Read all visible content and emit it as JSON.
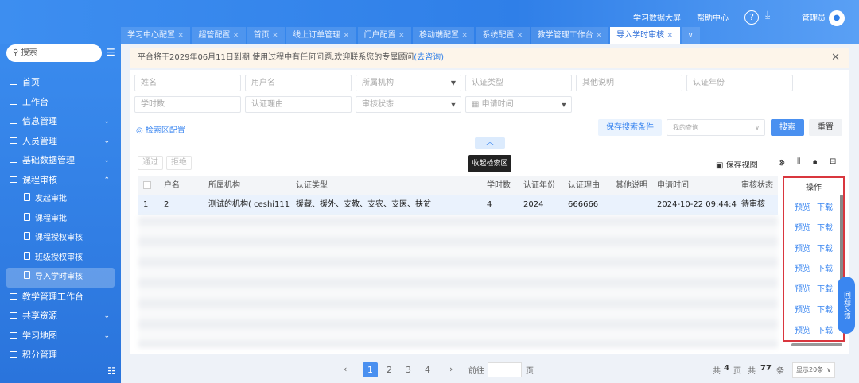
{
  "header": {
    "data_screen": "学习数据大屏",
    "help": "帮助中心",
    "user": "管理员"
  },
  "tabs": [
    {
      "label": "学习中心配置"
    },
    {
      "label": "超管配置"
    },
    {
      "label": "首页"
    },
    {
      "label": "线上订单管理"
    },
    {
      "label": "门户配置"
    },
    {
      "label": "移动端配置"
    },
    {
      "label": "系统配置"
    },
    {
      "label": "教学管理工作台"
    },
    {
      "label": "导入学时审核",
      "active": true
    }
  ],
  "sidebar": {
    "search": "搜索",
    "items": [
      {
        "label": "首页"
      },
      {
        "label": "工作台"
      },
      {
        "label": "信息管理",
        "arrow": "⌄"
      },
      {
        "label": "人员管理",
        "arrow": "⌄"
      },
      {
        "label": "基础数据管理",
        "arrow": "⌄"
      },
      {
        "label": "课程审核",
        "arrow": "⌃"
      },
      {
        "label": "发起审批",
        "sub": true
      },
      {
        "label": "课程审批",
        "sub": true
      },
      {
        "label": "课程授权审核",
        "sub": true
      },
      {
        "label": "班级授权审核",
        "sub": true
      },
      {
        "label": "导入学时审核",
        "sub": true,
        "active": true
      },
      {
        "label": "教学管理工作台"
      },
      {
        "label": "共享资源",
        "arrow": "⌄"
      },
      {
        "label": "学习地图",
        "arrow": "⌄"
      },
      {
        "label": "积分管理"
      }
    ]
  },
  "notice": {
    "text": "平台将于2029年06月11日到期,使用过程中有任何问题,欢迎联系您的专属顾问",
    "link": "(去咨询)"
  },
  "filters": {
    "name": "姓名",
    "username": "用户名",
    "org": "所属机构",
    "cert_type": "认证类型",
    "other": "其他说明",
    "cert_year": "认证年份",
    "hours": "学时数",
    "reason": "认证理由",
    "status": "审核状态",
    "apply_time": "申请时间"
  },
  "actions": {
    "config": "检索区配置",
    "save_search": "保存搜索条件",
    "my_query": "我的查询",
    "search": "搜索",
    "reset": "重置",
    "collapse_tip": "收起检索区",
    "approve": "通过",
    "reject": "拒绝",
    "save_view": "保存视图"
  },
  "table": {
    "columns": [
      "",
      "户名",
      "所属机构",
      "认证类型",
      "学时数",
      "认证年份",
      "认证理由",
      "其他说明",
      "申请时间",
      "审核状态"
    ],
    "rows": [
      [
        "1",
        "2",
        "测试的机构( ceshi111 )",
        "援藏、援外、支教、支农、支医、扶贫",
        "4",
        "2024",
        "666666",
        "",
        "2024-10-22 09:44:40",
        "待审核"
      ]
    ],
    "op_header": "操作",
    "preview": "预览",
    "download": "下载"
  },
  "pagination": {
    "pages": [
      "1",
      "2",
      "3",
      "4"
    ],
    "current": "1",
    "goto": "前往",
    "page_unit": "页",
    "total_pages_label": "共",
    "total_pages": "4",
    "pages_unit": "页",
    "total_label": "共",
    "total": "77",
    "total_unit": "条",
    "page_size": "显示20条"
  },
  "float_btn": "问题反馈"
}
